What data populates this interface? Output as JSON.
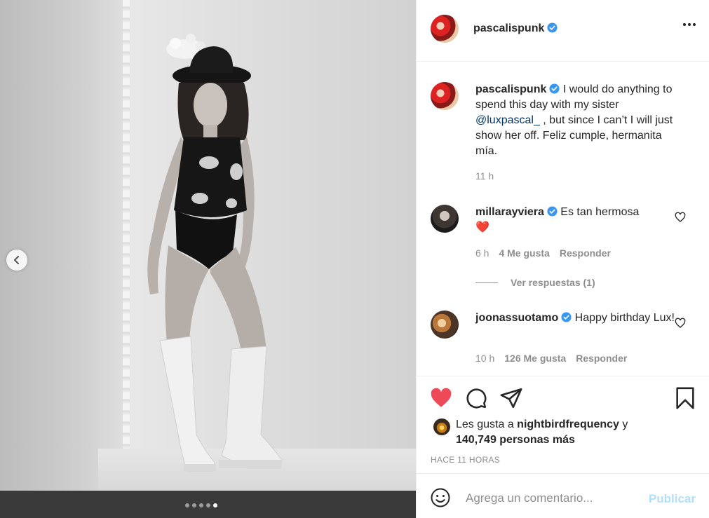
{
  "post": {
    "author": "pascalispunk",
    "photo_alt": "Black and white photo",
    "carousel": {
      "slide_count": 5,
      "active_index": 4
    }
  },
  "header": {
    "username": "pascalispunk"
  },
  "caption": {
    "username": "pascalispunk",
    "text_before": " I would do anything to spend this day with my sister ",
    "mention": "@luxpascal_",
    "text_after": " , but since I can’t I will just show her off. Feliz cumple, hermanita mía.",
    "time": "11 h"
  },
  "comments": [
    {
      "username": "millarayviera",
      "text": " Es tan hermosa",
      "emoji": "❤️",
      "time": "6 h",
      "likes": "4 Me gusta",
      "reply": "Responder",
      "view_replies": "Ver respuestas (1)"
    },
    {
      "username": "joonassuotamo",
      "text": " Happy birthday Lux!",
      "time": "10 h",
      "likes": "126 Me gusta",
      "reply": "Responder"
    }
  ],
  "likes": {
    "prefix": "Les gusta a ",
    "user": "nightbirdfrequency",
    "mid": " y ",
    "others": "140,749 personas más"
  },
  "timestamp": "HACE 11 HORAS",
  "comment_input": {
    "placeholder": "Agrega un comentario...",
    "publish": "Publicar"
  },
  "colors": {
    "like_red": "#ed4956",
    "verified_blue": "#3897f0",
    "mention": "#00376b",
    "publish_disabled": "#b2dffc"
  }
}
